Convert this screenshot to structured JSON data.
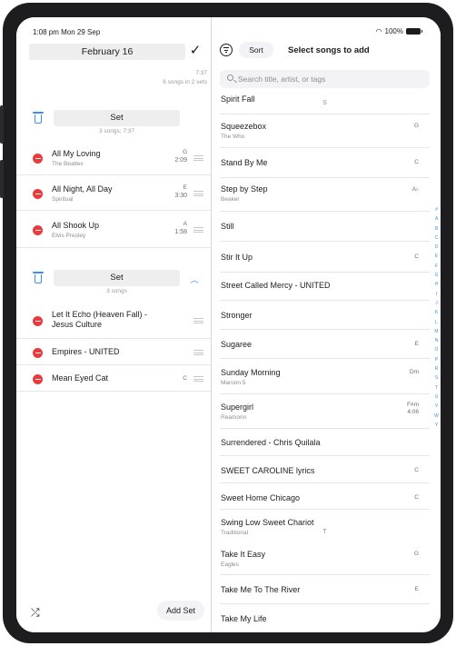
{
  "status_bar": {
    "time": "1:08 pm  Mon 29 Sep",
    "battery": "100%"
  },
  "setlist": {
    "title": "February 16",
    "total_time": "7:37",
    "summary": "6 songs in 2 sets",
    "sets": [
      {
        "label": "Set",
        "subtitle": "3 songs; 7:37",
        "songs": [
          {
            "title": "All My Loving",
            "artist": "The Beatles",
            "key": "G",
            "duration": "2:09"
          },
          {
            "title": "All Night, All Day",
            "artist": "Spiritual",
            "key": "E",
            "duration": "3:30"
          },
          {
            "title": "All Shook Up",
            "artist": "Elvis Presley",
            "key": "A",
            "duration": "1:58"
          }
        ]
      },
      {
        "label": "Set",
        "subtitle": "3 songs",
        "songs": [
          {
            "title": "Let It Echo (Heaven Fall) - Jesus Culture"
          },
          {
            "title": "Empires - UNITED"
          },
          {
            "title": "Mean Eyed Cat",
            "key": "C"
          }
        ]
      }
    ],
    "add_set_label": "Add Set"
  },
  "library": {
    "title": "Select songs to add",
    "sort_label": "Sort",
    "search_placeholder": "Search title, artist, or tags",
    "sections": [
      {
        "letter": "S",
        "rows": [
          {
            "title": "Spirit Fall"
          },
          {
            "title": "Squeezebox",
            "subtitle": "The Who",
            "key": "G"
          },
          {
            "title": "Stand By Me",
            "key": "C"
          },
          {
            "title": "Step by Step",
            "subtitle": "Beaker",
            "key": "A♭"
          },
          {
            "title": "Still"
          },
          {
            "title": "Stir It Up",
            "key": "C"
          },
          {
            "title": "Street Called Mercy - UNITED"
          },
          {
            "title": "Stronger"
          },
          {
            "title": "Sugaree",
            "key": "E"
          },
          {
            "title": "Sunday Morning",
            "subtitle": "Maroon 5",
            "key": "Dm"
          },
          {
            "title": "Supergirl",
            "subtitle": "Reamonn",
            "key": "F#m",
            "duration": "4:06"
          },
          {
            "title": "Surrendered - Chris Quilala"
          },
          {
            "title": "SWEET CAROLINE lyrics",
            "key": "C"
          },
          {
            "title": "Sweet Home Chicago",
            "key": "C"
          },
          {
            "title": "Swing Low Sweet Chariot",
            "subtitle": "Traditional"
          }
        ]
      },
      {
        "letter": "T",
        "rows": [
          {
            "title": "Take It Easy",
            "subtitle": "Eagles",
            "key": "G"
          },
          {
            "title": "Take Me To The River",
            "key": "E"
          },
          {
            "title": "Take My Life"
          }
        ]
      }
    ],
    "index_letters": [
      "#",
      "A",
      "B",
      "C",
      "D",
      "E",
      "F",
      "G",
      "H",
      "I",
      "J",
      "K",
      "L",
      "M",
      "N",
      "O",
      "P",
      "R",
      "S",
      "T",
      "U",
      "V",
      "W",
      "Y"
    ]
  },
  "colors": {
    "accent": "#3d8fe8",
    "delete": "#ea3a3b",
    "separator": "#e5e5ea"
  }
}
